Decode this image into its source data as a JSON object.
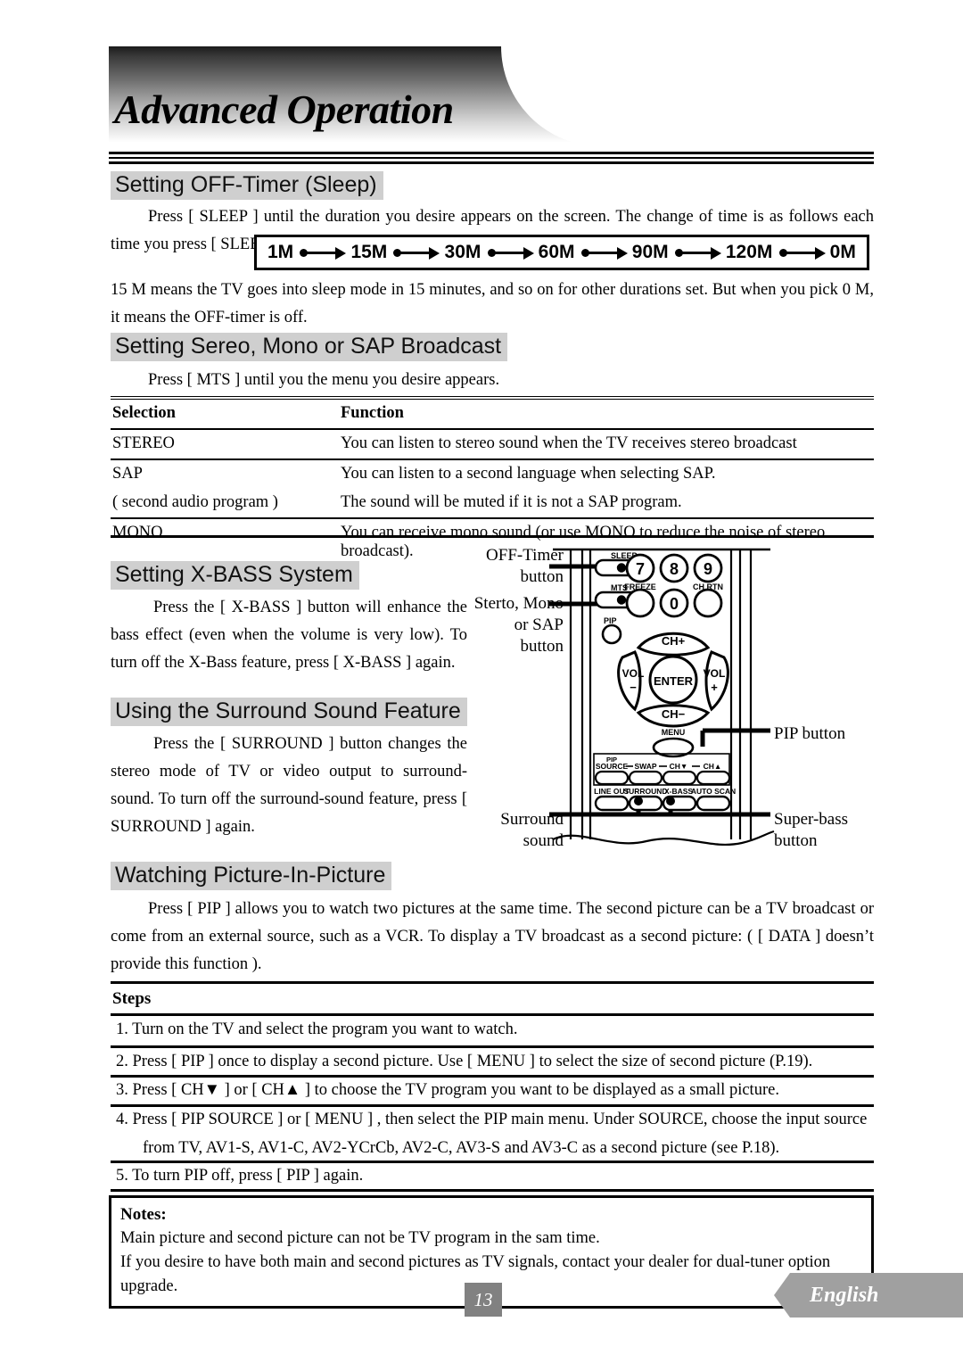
{
  "header": {
    "title": "Advanced Operation"
  },
  "sections": {
    "sleep": {
      "heading": "Setting OFF-Timer (Sleep)",
      "para_before": "Press [ SLEEP ] until the duration you desire appears on the screen. The change of time is as follows each time you press [ SLEEP ] :",
      "sequence": [
        "1M",
        "15M",
        "30M",
        "60M",
        "90M",
        "120M",
        "0M"
      ],
      "para_after": "15 M means the TV goes into sleep mode in 15 minutes, and so on for other durations set. But when you pick 0 M, it means the OFF-timer is off."
    },
    "mts": {
      "heading": "Setting Sereo, Mono or SAP Broadcast",
      "intro": "Press [ MTS ] until you the menu you desire appears.",
      "table": {
        "columns": [
          "Selection",
          "Function"
        ],
        "rows": [
          {
            "selection": "STEREO",
            "function": "You can listen to stereo sound when the TV receives stereo broadcast"
          },
          {
            "selection": "SAP",
            "function": "You can listen to a second language when selecting SAP."
          },
          {
            "selection": "( second audio program )",
            "function": "The sound will be muted if it is not a SAP program."
          },
          {
            "selection": "MONO",
            "function": "You can receive mono sound (or use MONO to reduce the noise of stereo broadcast)."
          }
        ]
      }
    },
    "xbass": {
      "heading": "Setting X-BASS System",
      "body": "Press the [ X-BASS ] button will enhance the bass effect (even when the volume is very low). To turn off the X-Bass feature, press [ X-BASS ] again."
    },
    "surround": {
      "heading": "Using the Surround Sound Feature",
      "body": "Press the [ SURROUND ] button changes the stereo mode of TV or video output to surround-sound. To turn off the surround-sound feature, press [ SURROUND ] again."
    },
    "pip": {
      "heading": "Watching Picture-In-Picture",
      "body": "Press [ PIP ] allows you to watch two pictures at the same time. The second picture can be a TV broadcast or come from an external source, such as a VCR. To display a TV broadcast as a second picture: ( [ DATA ] doesn’t provide this function ).",
      "steps_header": "Steps",
      "steps": [
        "1.  Turn on the TV and select the program you want to watch.",
        "2.  Press [ PIP ] once to display a second picture. Use [ MENU ] to select the size of second picture (P.19).",
        "3.  Press [ CH▼ ] or [ CH▲ ] to choose the TV program you want to be displayed as a small picture.",
        "4.  Press [ PIP SOURCE ] or [ MENU ] , then select the PIP main menu. Under SOURCE, choose the input source",
        "from TV, AV1-S, AV1-C, AV2-YCrCb, AV2-C, AV3-S and AV3-C as a second picture (see P.18).",
        "5.  To turn PIP off, press [ PIP ] again."
      ]
    }
  },
  "notes": {
    "title": "Notes:",
    "lines": [
      "Main picture and second picture can not be TV program in the sam time.",
      "If you desire to have both main and second pictures as TV signals, contact your dealer for dual-tuner option upgrade."
    ]
  },
  "remote": {
    "callouts": {
      "off_timer": "OFF-Timer\nbutton",
      "off_timer_l1": "OFF-Timer",
      "off_timer_l2": "button",
      "mts_l1": "Sterto, Mono",
      "mts_l2": "or SAP",
      "mts_l3": "button",
      "pip": "PIP button",
      "superbass_l1": "Super-bass",
      "superbass_l2": "button",
      "surround_l1": "Surround",
      "surround_l2": "sound"
    },
    "buttons": {
      "sleep": "SLEEP",
      "mts": "MTS",
      "pip": "PIP",
      "freeze": "FREEZE",
      "chrtn": "CH RTN",
      "num7": "7",
      "num8": "8",
      "num9": "9",
      "num0": "0",
      "ch_up": "CH+",
      "ch_down": "CH−",
      "vol_down_l1": "VOL",
      "vol_down_l2": "−",
      "vol_up_l1": "VOL",
      "vol_up_l2": "+",
      "enter": "ENTER",
      "menu": "MENU",
      "pip_source_l1": "PIP",
      "pip_source_l2": "SOURCE",
      "swap": "SWAP",
      "pip_ch_down": "CH▼",
      "pip_ch_up": "CH▲",
      "line_out": "LINE OUT",
      "surround": "SURROUND",
      "xbass": "X-BASS",
      "auto_scan": "AUTO SCAN"
    }
  },
  "footer": {
    "page_number": "13",
    "language": "English"
  },
  "colors": {
    "heading_highlight": "#cfcfcf",
    "page_badge": "#818181",
    "lang_tab": "#a0a0a0"
  }
}
